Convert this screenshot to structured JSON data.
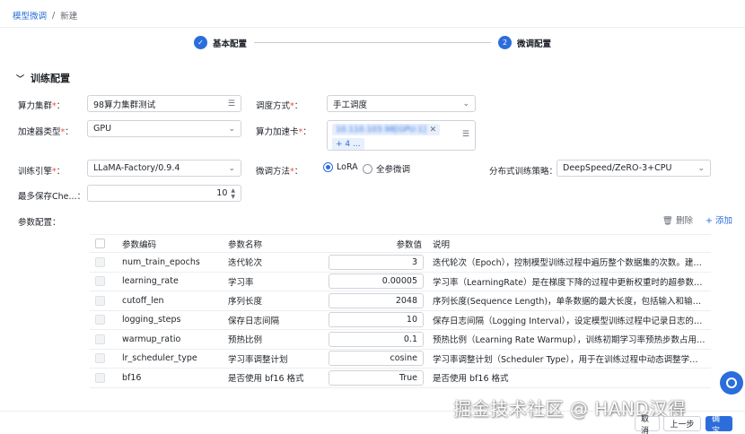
{
  "breadcrumb": {
    "parent": "模型微调",
    "separator": "/",
    "current": "新建"
  },
  "steps": [
    {
      "index": "✓",
      "label": "基本配置"
    },
    {
      "index": "2",
      "label": "微调配置"
    }
  ],
  "section": {
    "title": "训练配置"
  },
  "form": {
    "cluster_label": "算力集群",
    "cluster_value": "98算力集群测试",
    "schedule_label": "调度方式",
    "schedule_value": "手工调度",
    "accel_type_label": "加速器类型",
    "accel_type_value": "GPU",
    "accel_card_label": "算力加速卡",
    "accel_card_chip": "10.110.103.98[GPU:1]",
    "accel_card_more": "+ 4 ...",
    "engine_label": "训练引擎",
    "engine_value": "LLaMA-Factory/0.9.4",
    "method_label": "微调方法",
    "method_lora": "LoRA",
    "method_full": "全参微调",
    "strategy_label": "分布式训练策略",
    "strategy_value": "DeepSpeed/ZeRO-3+CPU",
    "keep_label": "最多保存Che...",
    "keep_value": "10",
    "params_label": "参数配置",
    "required_mark": "*",
    "colon": "："
  },
  "actions": {
    "delete": "删除",
    "add": "添加",
    "delete_icon": "trash-icon",
    "add_icon": "plus-icon"
  },
  "table": {
    "headers": {
      "code": "参数编码",
      "name": "参数名称",
      "value": "参数值",
      "desc": "说明"
    },
    "rows": [
      {
        "code": "num_train_epochs",
        "name": "迭代轮次",
        "value": "3",
        "desc": "迭代轮次（Epoch），控制模型训练过程中遍历整个数据集的次数。建议..."
      },
      {
        "code": "learning_rate",
        "name": "学习率",
        "value": "0.00005",
        "desc": "学习率（LearningRate）是在梯度下降的过程中更新权重时的超参数，..."
      },
      {
        "code": "cutoff_len",
        "name": "序列长度",
        "value": "2048",
        "desc": "序列长度(Sequence Length)，单条数据的最大长度，包括输入和输出..."
      },
      {
        "code": "logging_steps",
        "name": "保存日志间隔",
        "value": "10",
        "desc": "保存日志间隔（Logging Interval），设定模型训练过程中记录日志的间..."
      },
      {
        "code": "warmup_ratio",
        "name": "预热比例",
        "value": "0.1",
        "desc": "预热比例（Learning Rate Warmup），训练初期学习率预热步数占用总..."
      },
      {
        "code": "lr_scheduler_type",
        "name": "学习率调整计划",
        "value": "cosine",
        "desc": "学习率调整计划（Scheduler Type），用于在训练过程中动态调整学习..."
      },
      {
        "code": "bf16",
        "name": "是否使用 bf16 格式",
        "value": "True",
        "desc": "是否使用 bf16 格式"
      }
    ]
  },
  "watermark": "掘金技术社区 @ HAND汉得",
  "footer": {
    "cancel": "取消",
    "prev": "上一步",
    "ok": "确定"
  },
  "colors": {
    "primary": "#2b6ddb",
    "required": "#f54a45",
    "border": "#d0d3d9"
  }
}
